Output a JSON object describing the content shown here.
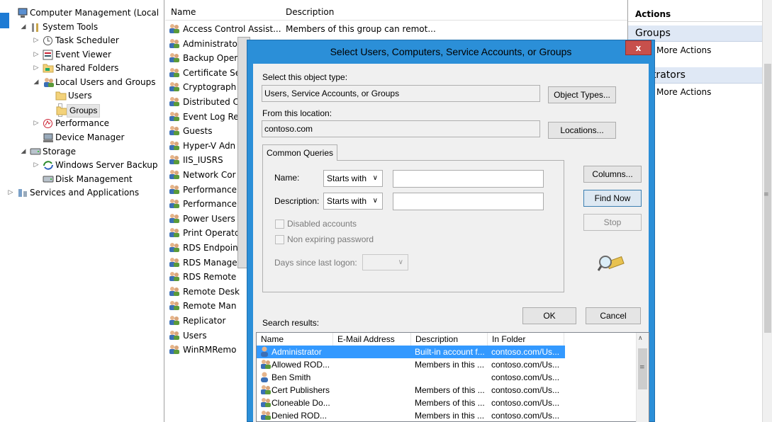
{
  "tree": {
    "items": [
      {
        "label": "Computer Management (Local",
        "arrow": "",
        "icon": "computer-management-icon",
        "indent": 0
      },
      {
        "label": "System Tools",
        "arrow": "◢",
        "icon": "tools-icon",
        "indent": 1
      },
      {
        "label": "Task Scheduler",
        "arrow": "▷",
        "icon": "clock-icon",
        "indent": 2
      },
      {
        "label": "Event Viewer",
        "arrow": "▷",
        "icon": "event-viewer-icon",
        "indent": 2
      },
      {
        "label": "Shared Folders",
        "arrow": "▷",
        "icon": "shared-folder-icon",
        "indent": 2
      },
      {
        "label": "Local Users and Groups",
        "arrow": "◢",
        "icon": "users-icon",
        "indent": 2
      },
      {
        "label": "Users",
        "arrow": "",
        "icon": "folder-icon",
        "indent": 3
      },
      {
        "label": "Groups",
        "arrow": "",
        "icon": "folder-icon",
        "indent": 3,
        "selected": true
      },
      {
        "label": "Performance",
        "arrow": "▷",
        "icon": "performance-icon",
        "indent": 2
      },
      {
        "label": "Device Manager",
        "arrow": "",
        "icon": "device-manager-icon",
        "indent": 2
      },
      {
        "label": "Storage",
        "arrow": "◢",
        "icon": "storage-icon",
        "indent": 1
      },
      {
        "label": "Windows Server Backup",
        "arrow": "▷",
        "icon": "backup-icon",
        "indent": 2
      },
      {
        "label": "Disk Management",
        "arrow": "",
        "icon": "disk-icon",
        "indent": 2
      },
      {
        "label": "Services and Applications",
        "arrow": "▷",
        "icon": "services-icon",
        "indent": 0
      }
    ]
  },
  "list": {
    "col_name": "Name",
    "col_description": "Description",
    "rows": [
      {
        "name": "Access Control Assist...",
        "desc": "Members of this group can remot..."
      },
      {
        "name": "Administrato",
        "desc": ""
      },
      {
        "name": "Backup Oper",
        "desc": ""
      },
      {
        "name": "Certificate Se",
        "desc": ""
      },
      {
        "name": "Cryptograph",
        "desc": ""
      },
      {
        "name": "Distributed C",
        "desc": ""
      },
      {
        "name": "Event Log Re",
        "desc": ""
      },
      {
        "name": "Guests",
        "desc": ""
      },
      {
        "name": "Hyper-V Adn",
        "desc": ""
      },
      {
        "name": "IIS_IUSRS",
        "desc": ""
      },
      {
        "name": "Network Cor",
        "desc": ""
      },
      {
        "name": "Performance",
        "desc": ""
      },
      {
        "name": "Performance",
        "desc": ""
      },
      {
        "name": "Power Users",
        "desc": ""
      },
      {
        "name": "Print Operatc",
        "desc": ""
      },
      {
        "name": "RDS Endpoin",
        "desc": ""
      },
      {
        "name": "RDS Manage",
        "desc": ""
      },
      {
        "name": "RDS Remote",
        "desc": ""
      },
      {
        "name": "Remote Desk",
        "desc": ""
      },
      {
        "name": "Remote Man",
        "desc": ""
      },
      {
        "name": "Replicator",
        "desc": ""
      },
      {
        "name": "Users",
        "desc": ""
      },
      {
        "name": "WinRMRemo",
        "desc": ""
      }
    ]
  },
  "actions": {
    "header": "Actions",
    "section1": "Groups",
    "more1": "More Actions",
    "section2": "Administrators",
    "section2_visible": "inistrators",
    "more2": "More Actions"
  },
  "dialog": {
    "title": "Select Users, Computers, Service Accounts, or Groups",
    "close": "x",
    "object_type_label": "Select this object type:",
    "object_type_value": "Users, Service Accounts, or Groups",
    "object_types_button": "Object Types...",
    "location_label": "From this location:",
    "location_value": "contoso.com",
    "locations_button": "Locations...",
    "tab_common_queries": "Common Queries",
    "name_label": "Name:",
    "name_match": "Starts with",
    "description_label": "Description:",
    "description_match": "Starts with",
    "disabled_accounts": "Disabled accounts",
    "non_expiring_password": "Non expiring password",
    "days_since_logon": "Days since last logon:",
    "columns_button": "Columns...",
    "find_now_button": "Find Now",
    "stop_button": "Stop",
    "ok_button": "OK",
    "cancel_button": "Cancel",
    "search_results_label": "Search results:"
  },
  "results": {
    "headers": [
      "Name",
      "E-Mail Address",
      "Description",
      "In Folder"
    ],
    "rows": [
      {
        "name": "Administrator",
        "email": "",
        "desc": "Built-in account f...",
        "folder": "contoso.com/Us...",
        "icon": "user-icon",
        "selected": true
      },
      {
        "name": "Allowed ROD...",
        "email": "",
        "desc": "Members in this ...",
        "folder": "contoso.com/Us...",
        "icon": "group-icon"
      },
      {
        "name": "Ben Smith",
        "email": "",
        "desc": "",
        "folder": "contoso.com/Us...",
        "icon": "user-icon"
      },
      {
        "name": "Cert Publishers",
        "email": "",
        "desc": "Members of this ...",
        "folder": "contoso.com/Us...",
        "icon": "group-icon"
      },
      {
        "name": "Cloneable Do...",
        "email": "",
        "desc": "Members of this ...",
        "folder": "contoso.com/Us...",
        "icon": "group-icon"
      },
      {
        "name": "Denied ROD...",
        "email": "",
        "desc": "Members in this ...",
        "folder": "contoso.com/Us...",
        "icon": "group-icon"
      }
    ]
  },
  "colors": {
    "dialog_frame": "#2b8fd8",
    "selection": "#3399ff",
    "close_button": "#c7504c",
    "actions_header": "#dfe8f5"
  }
}
